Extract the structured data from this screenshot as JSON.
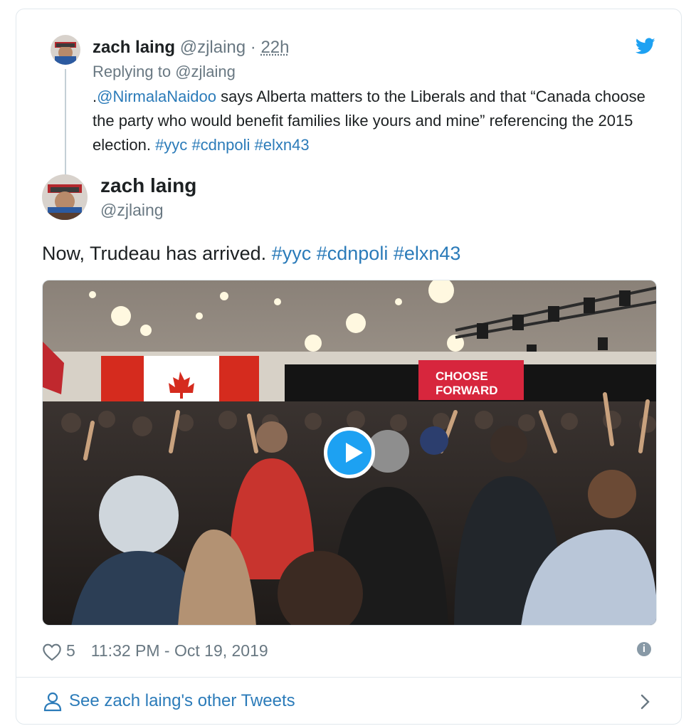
{
  "parent_tweet": {
    "name": "zach laing",
    "handle": "@zjlaing",
    "separator": "·",
    "time": "22h",
    "replying_label": "Replying to",
    "replying_handle": "@zjlaing",
    "text_prefix": ".",
    "mention": "@NirmalaNaidoo",
    "text_body": " says Alberta matters to the Liberals and that “Canada choose the party who would benefit families like yours and mine” referencing the 2015 election. ",
    "hashtags": [
      "#yyc",
      "#cdnpoli",
      "#elxn43"
    ]
  },
  "main_tweet": {
    "name": "zach laing",
    "handle": "@zjlaing",
    "text": "Now, Trudeau has arrived.",
    "hashtags": [
      "#yyc",
      "#cdnpoli",
      "#elxn43"
    ],
    "banner_text": "CHOOSE FORWARD",
    "likes": "5",
    "timestamp": "11:32 PM - Oct 19, 2019"
  },
  "footer": {
    "link_text": "See zach laing's other Tweets"
  },
  "icons": {
    "brand": "twitter-bird-icon",
    "like": "heart-icon",
    "info": "info-icon",
    "profile": "person-icon",
    "next": "chevron-right-icon",
    "play": "play-icon"
  },
  "colors": {
    "link": "#2b7bb9",
    "twitter_blue": "#1da1f2",
    "muted": "#697882",
    "border": "#e1e8ed"
  }
}
